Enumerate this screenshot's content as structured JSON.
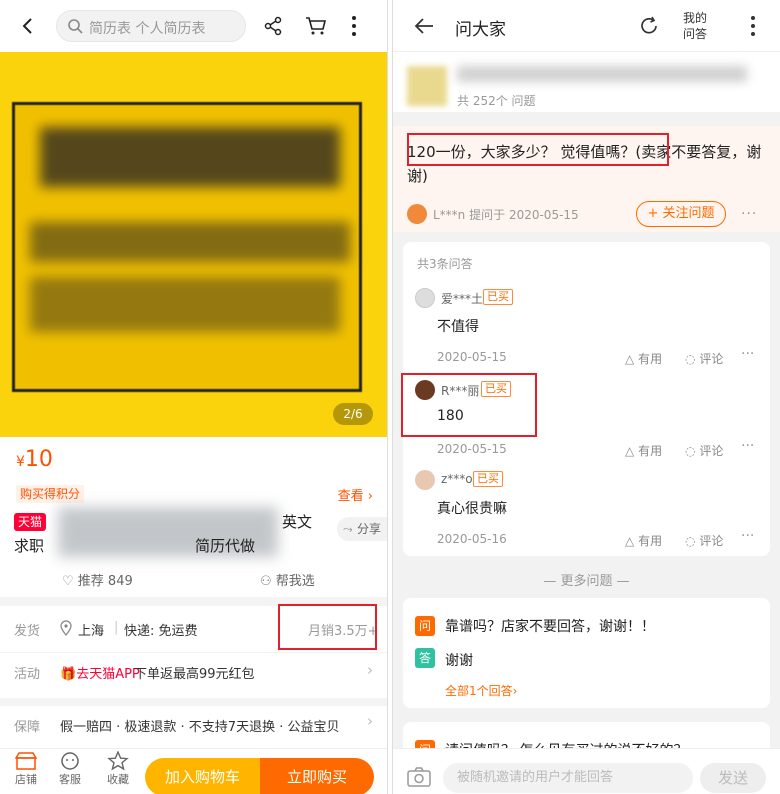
{
  "left": {
    "search_placeholder": "简历表 个人简历表",
    "image_counter": "2/6",
    "price_symbol": "¥",
    "price_value": "10",
    "points_tag": "购买得积分",
    "view_link": "查看 ›",
    "badge": "天猫",
    "title_tail": "英文",
    "title_line2_head": "求职",
    "title_line2_tail": "简历代做",
    "share_label": "分享",
    "recommend_label": "推荐 849",
    "help_select_label": "帮我选",
    "ship": {
      "label": "发货",
      "location": "上海",
      "delivery": "快递: 免运费",
      "monthly_sales": "月销3.5万+"
    },
    "promo": {
      "label": "活动",
      "app_link": "去天猫APP",
      "text": "下单返最高99元红包"
    },
    "guarantee": {
      "label": "保障",
      "text": "假一赔四 · 极速退款 · 不支持7天退换 · 公益宝贝"
    },
    "bottom": {
      "shop": "店铺",
      "service": "客服",
      "favorite": "收藏",
      "add_cart": "加入购物车",
      "buy_now": "立即购买"
    }
  },
  "right": {
    "title": "问大家",
    "my_qa_line1": "我的",
    "my_qa_line2": "问答",
    "summary_count": "共 252个 问题",
    "question": {
      "text": "120一份，大家多少？ 觉得值嗎？(卖家不要答复，谢谢)",
      "asker": "L***n",
      "asked_at": "提问于 2020-05-15",
      "follow": "+ 关注问题"
    },
    "answers_count": "共3条问答",
    "answers": [
      {
        "name": "爱***土",
        "bought": "已买",
        "text": "不值得",
        "date": "2020-05-15",
        "useful": "有用",
        "comment": "评论"
      },
      {
        "name": "R***丽",
        "bought": "已买",
        "text": "180",
        "date": "2020-05-15",
        "useful": "有用",
        "comment": "评论"
      },
      {
        "name": "z***o",
        "bought": "已买",
        "text": "真心很贵嘛",
        "date": "2020-05-16",
        "useful": "有用",
        "comment": "评论"
      }
    ],
    "more_questions": "更多问题",
    "q2": {
      "q_icon": "问",
      "a_icon": "答",
      "question": "靠谱吗？店家不要回答，谢谢！！",
      "answer": "谢谢",
      "all_answers": "全部1个回答›"
    },
    "q3_text": "请问值吗？ 怎么见有买过的说不好的？",
    "input_placeholder": "被随机邀请的用户才能回答",
    "send": "发送"
  },
  "colors": {
    "brand_orange": "#ff5000",
    "tmall_red": "#ff0036",
    "image_yellow": "#fbd30d",
    "highlight_red": "#e0202a"
  }
}
